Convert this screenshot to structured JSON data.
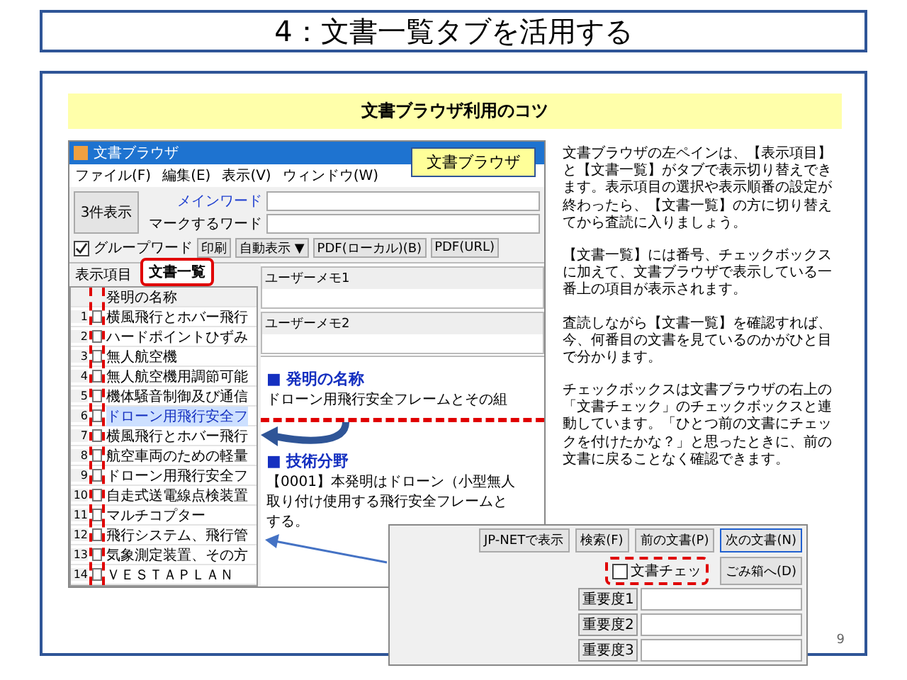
{
  "slide_title": "4：文書一覧タブを活用する",
  "section_heading": "文書ブラウザ利用のコツ",
  "app": {
    "title": "文書ブラウザ",
    "callout": "文書ブラウザ",
    "menu": [
      "ファイル(F)",
      "編集(E)",
      "表示(V)",
      "ウィンドウ(W)"
    ],
    "count_button": "3件表示",
    "fields": [
      {
        "label": "メインワード"
      },
      {
        "label": "マークするワード"
      }
    ],
    "group_word": {
      "label": "グループワード",
      "checked": true
    },
    "toolbar": [
      "印刷",
      "自動表示 ▼",
      "PDF(ローカル)(B)",
      "PDF(URL)"
    ],
    "tabs": [
      {
        "label": "表示項目",
        "selected": false
      },
      {
        "label": "文書一覧",
        "selected": true
      }
    ],
    "list_header": "発明の名称",
    "rows": [
      {
        "number": "1",
        "title": "横風飛行とホバー飛行",
        "checked": false,
        "selected": false
      },
      {
        "number": "2",
        "title": "ハードポイントひずみ",
        "checked": false,
        "selected": false
      },
      {
        "number": "3",
        "title": "無人航空機",
        "checked": false,
        "selected": false
      },
      {
        "number": "4",
        "title": "無人航空機用調節可能",
        "checked": false,
        "selected": false
      },
      {
        "number": "5",
        "title": "機体騒音制御及び通信",
        "checked": false,
        "selected": false
      },
      {
        "number": "6",
        "title": "ドローン用飛行安全フ",
        "checked": false,
        "selected": true
      },
      {
        "number": "7",
        "title": "横風飛行とホバー飛行",
        "checked": false,
        "selected": false
      },
      {
        "number": "8",
        "title": "航空車両のための軽量",
        "checked": false,
        "selected": false
      },
      {
        "number": "9",
        "title": "ドローン用飛行安全フ",
        "checked": false,
        "selected": false
      },
      {
        "number": "10",
        "title": "自走式送電線点検装置",
        "checked": false,
        "selected": false
      },
      {
        "number": "11",
        "title": "マルチコプター",
        "checked": false,
        "selected": false
      },
      {
        "number": "12",
        "title": "飛行システム、飛行管",
        "checked": false,
        "selected": false
      },
      {
        "number": "13",
        "title": "気象測定装置、その方",
        "checked": false,
        "selected": false
      },
      {
        "number": "14",
        "title": "ＶＥＳＴＡＰＬＡＮ",
        "checked": false,
        "selected": false
      }
    ],
    "memos": [
      "ユーザーメモ1",
      "ユーザーメモ2"
    ],
    "sections": [
      {
        "heading": "■ 発明の名称",
        "lines": [
          "ドローン用飛行安全フレームとその組"
        ]
      },
      {
        "heading": "■ 技術分野",
        "lines": [
          "【0001】本発明はドローン（小型無人",
          "取り付け使用する飛行安全フレームと",
          "する。"
        ]
      }
    ]
  },
  "check_panel": {
    "buttons": [
      "JP-NETで表示",
      "検索(F)",
      "前の文書(P)",
      "次の文書(N)"
    ],
    "doc_check": {
      "label": "文書チェッ",
      "checked": false
    },
    "trash_button": "ごみ箱へ(D)",
    "importance": [
      "重要度1",
      "重要度2",
      "重要度3"
    ]
  },
  "paragraphs": [
    "文書ブラウザの左ペインは、【表示項目】と【文書一覧】がタブで表示切り替えできます。表示項目の選択や表示順番の設定が終わったら、【文書一覧】の方に切り替えてから査読に入りましょう。",
    "【文書一覧】には番号、チェックボックスに加えて、文書ブラウザで表示している一番上の項目が表示されます。",
    "査読しながら【文書一覧】を確認すれば、今、何番目の文書を見ているのかがひと目で分かります。",
    "チェックボックスは文書ブラウザの右上の「文書チェック」のチェックボックスと連動しています。「ひとつ前の文書にチェックを付けたかな？」と思ったときに、前の文書に戻ることなく確認できます。"
  ],
  "page_number": "9"
}
